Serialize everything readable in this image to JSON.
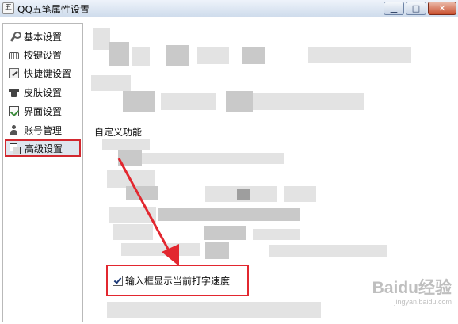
{
  "window": {
    "title": "QQ五笔属性设置",
    "minimize": "▁",
    "maximize": "□",
    "close": "✕"
  },
  "sidebar": {
    "items": [
      {
        "label": "基本设置",
        "icon": "wrench-icon",
        "selected": false
      },
      {
        "label": "按键设置",
        "icon": "keyboard-icon",
        "selected": false
      },
      {
        "label": "快捷键设置",
        "icon": "shortcut-icon",
        "selected": false
      },
      {
        "label": "皮肤设置",
        "icon": "skin-icon",
        "selected": false
      },
      {
        "label": "界面设置",
        "icon": "interface-icon",
        "selected": false
      },
      {
        "label": "账号管理",
        "icon": "account-icon",
        "selected": false
      },
      {
        "label": "高级设置",
        "icon": "advanced-icon",
        "selected": true
      }
    ]
  },
  "main": {
    "section_title": "自定义功能",
    "option": {
      "label": "输入框显示当前打字速度",
      "checked": true
    }
  },
  "watermark": {
    "brand": "Baidu经验",
    "sub": "jingyan.baidu.com"
  },
  "colors": {
    "highlight_red": "#e2272f",
    "selected_bg": "#dfe6ee"
  }
}
